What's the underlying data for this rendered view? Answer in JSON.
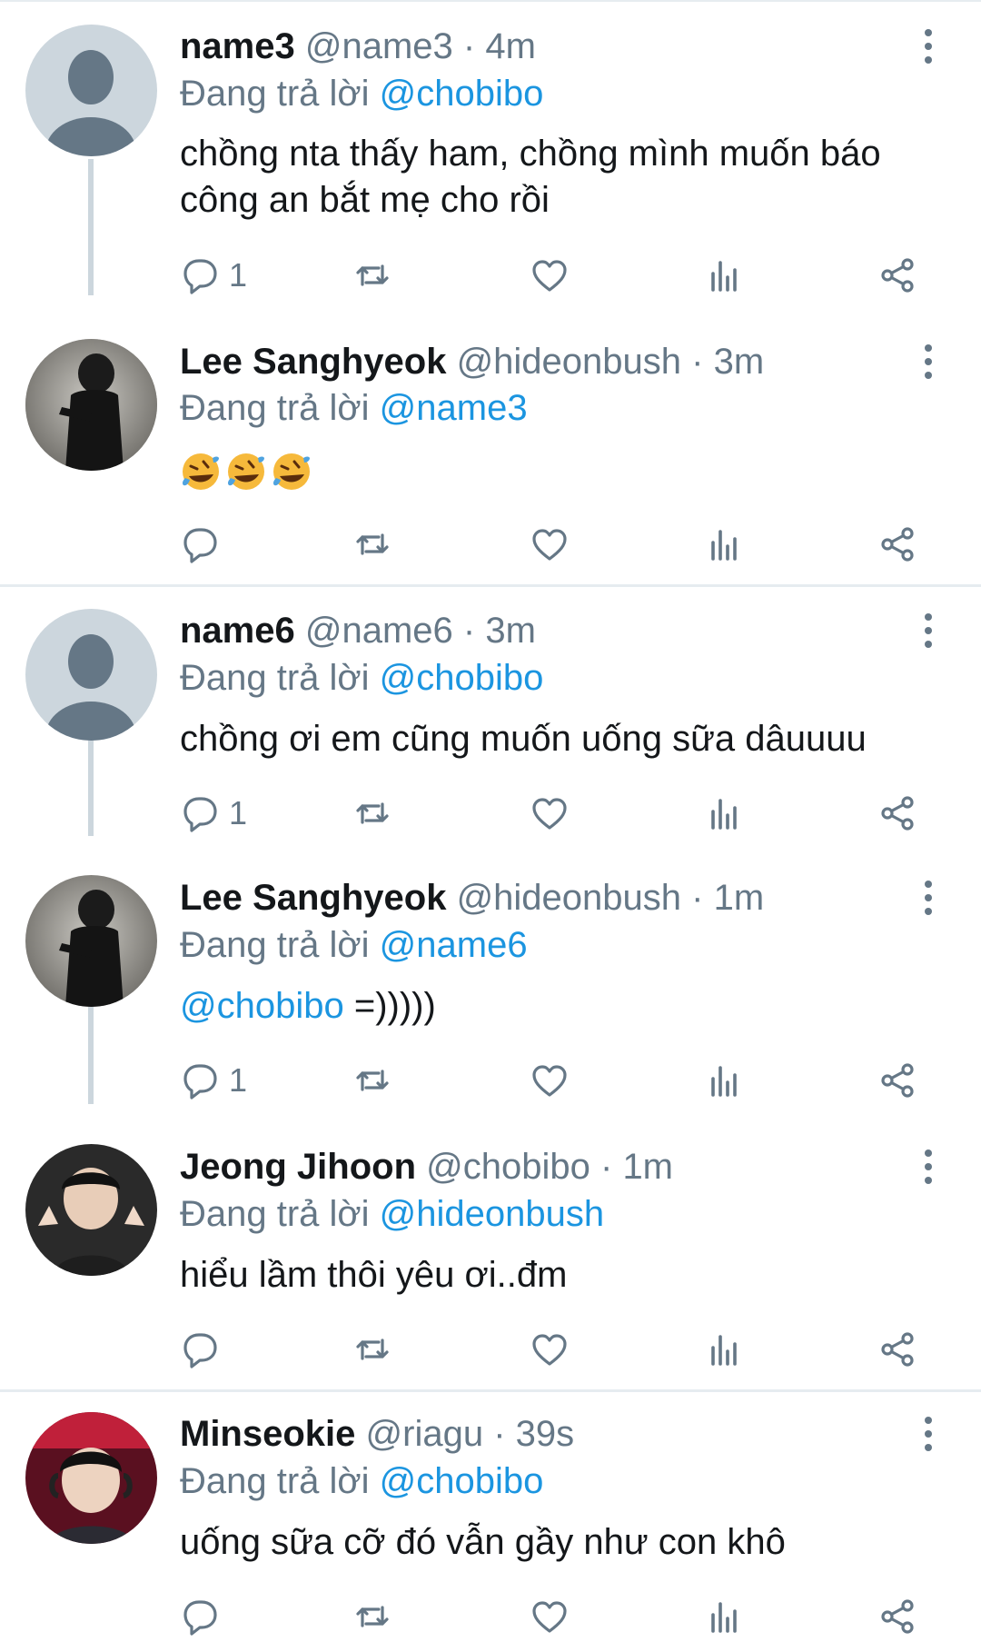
{
  "colors": {
    "link": "#1b95e0",
    "muted": "#657786",
    "text": "#14171a",
    "line": "#ccd6dd"
  },
  "replying_prefix": "Đang trả lời",
  "tweets": [
    {
      "name": "name3",
      "handle": "@name3",
      "dot": "·",
      "time": "4m",
      "reply_to": "@chobibo",
      "text": "chồng nta thấy ham, chồng mình muốn báo công an bắt mẹ cho rồi",
      "reply_count": "1",
      "avatar": "default-avatar-icon"
    },
    {
      "name": "Lee Sanghyeok",
      "handle": "@hideonbush",
      "dot": "·",
      "time": "3m",
      "reply_to": "@name3",
      "text_emoji": "rolling-on-floor-laughing x3",
      "reply_count": "",
      "avatar": "photo-avatar"
    },
    {
      "name": "name6",
      "handle": "@name6",
      "dot": "·",
      "time": "3m",
      "reply_to": "@chobibo",
      "text": "chồng ơi em cũng muốn uống sữa dâuuuu",
      "reply_count": "1",
      "avatar": "default-avatar-icon"
    },
    {
      "name": "Lee Sanghyeok",
      "handle": "@hideonbush",
      "dot": "·",
      "time": "1m",
      "reply_to": "@name6",
      "text_mention": "@chobibo",
      "text": " =)))))",
      "reply_count": "1",
      "avatar": "photo-avatar"
    },
    {
      "name": "Jeong Jihoon",
      "handle": "@chobibo",
      "dot": "·",
      "time": "1m",
      "reply_to": "@hideonbush",
      "text": "hiểu lầm thôi yêu ơi..đm",
      "reply_count": "",
      "avatar": "photo-avatar"
    },
    {
      "name": "Minseokie",
      "handle": "@riagu",
      "dot": "·",
      "time": "39s",
      "reply_to": "@chobibo",
      "text": "uống sữa cỡ đó vẫn gầy như con khô",
      "reply_count": "",
      "avatar": "photo-avatar"
    }
  ]
}
